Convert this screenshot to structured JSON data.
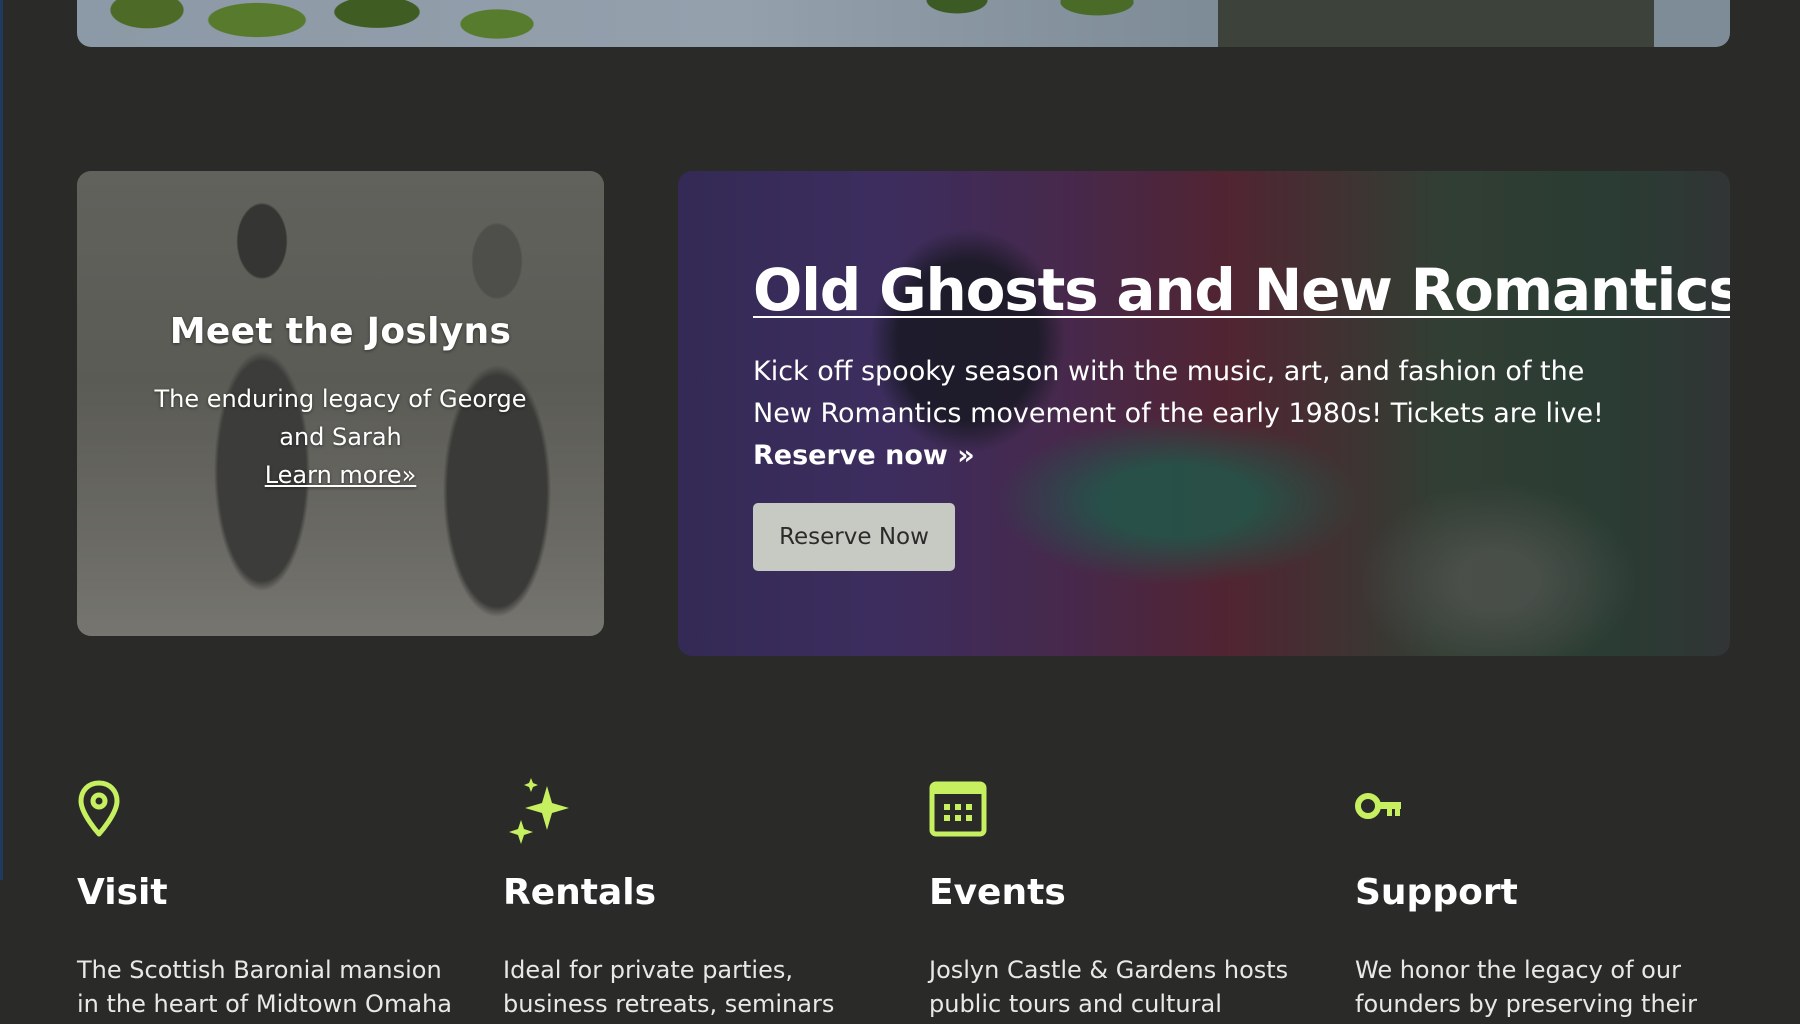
{
  "joslyn_card": {
    "title": "Meet the Joslyns",
    "description": "The enduring legacy of George and Sarah",
    "link": "Learn more»"
  },
  "event_card": {
    "title": "Old Ghosts and New Romantics",
    "description": "Kick off spooky season with the music, art, and fashion of the New Romantics movement of the early 1980s! Tickets are live! ",
    "description_bold": "Reserve now »",
    "button_label": "Reserve Now"
  },
  "features": [
    {
      "icon": "map-pin-icon",
      "title": "Visit",
      "text": "The Scottish Baronial mansion in the heart of Midtown Omaha"
    },
    {
      "icon": "sparkles-icon",
      "title": "Rentals",
      "text": "Ideal for private parties, business retreats, seminars"
    },
    {
      "icon": "calendar-icon",
      "title": "Events",
      "text": "Joslyn Castle & Gardens hosts public tours and cultural"
    },
    {
      "icon": "key-icon",
      "title": "Support",
      "text": "We honor the legacy of our founders by preserving their"
    }
  ],
  "colors": {
    "background": "#2a2b29",
    "accent": "#c6f060",
    "button_bg": "#c7c9c3"
  }
}
